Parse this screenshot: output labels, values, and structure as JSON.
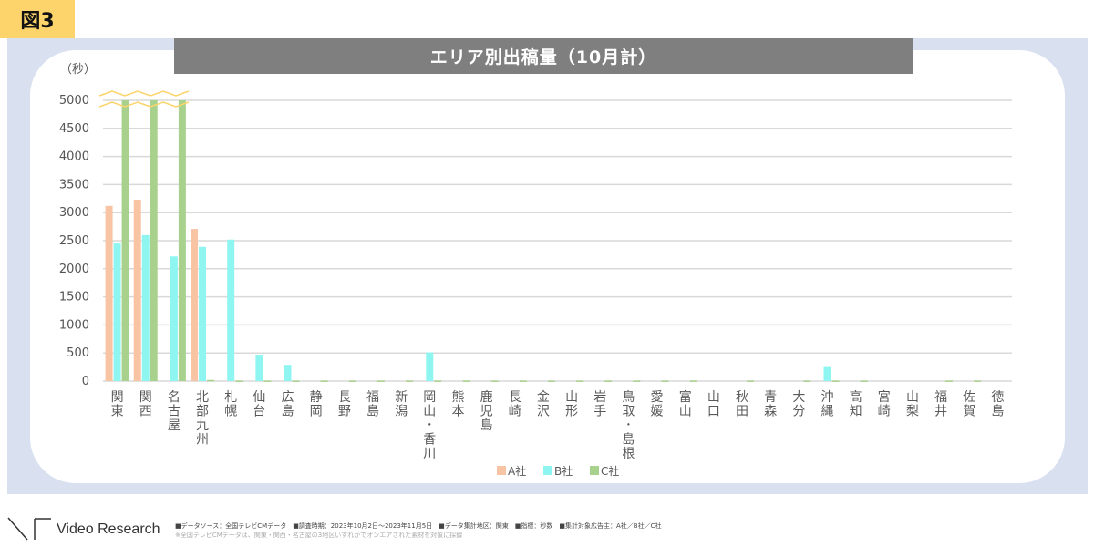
{
  "figure_label": "図3",
  "chart_data": {
    "type": "bar",
    "title": "エリア別出稿量（10月計）",
    "ylabel": "（秒）",
    "xlabel": "",
    "ylim": [
      0,
      5000
    ],
    "yticks": [
      0,
      500,
      1000,
      1500,
      2000,
      2500,
      3000,
      3500,
      4000,
      4500,
      5000
    ],
    "grid": true,
    "axis_break_note": "C社 values for 関東・関西・名古屋 exceed 5000 (axis broken)",
    "legend_position": "bottom",
    "categories": [
      "関東",
      "関西",
      "名古屋",
      "北部九州",
      "札幌",
      "仙台",
      "広島",
      "静岡",
      "長野",
      "福島",
      "新潟",
      "岡山・香川",
      "熊本",
      "鹿児島",
      "長崎",
      "金沢",
      "山形",
      "岩手",
      "鳥取・島根",
      "愛媛",
      "富山",
      "山口",
      "秋田",
      "青森",
      "大分",
      "沖縄",
      "高知",
      "宮崎",
      "山梨",
      "福井",
      "佐賀",
      "徳島"
    ],
    "series": [
      {
        "name": "A社",
        "color": "#f8c4a4",
        "values": [
          3120,
          3230,
          0,
          2710,
          0,
          0,
          0,
          0,
          0,
          0,
          0,
          0,
          0,
          0,
          0,
          0,
          0,
          0,
          0,
          0,
          0,
          0,
          0,
          0,
          0,
          0,
          0,
          0,
          0,
          0,
          0,
          0
        ]
      },
      {
        "name": "B社",
        "color": "#8ff5f0",
        "values": [
          2450,
          2600,
          2220,
          2390,
          2520,
          470,
          290,
          0,
          0,
          0,
          0,
          510,
          0,
          0,
          0,
          0,
          0,
          0,
          0,
          0,
          0,
          0,
          0,
          0,
          0,
          250,
          0,
          0,
          0,
          0,
          0,
          0
        ]
      },
      {
        "name": "C社",
        "color": "#a9d18e",
        "values": [
          5000,
          5000,
          5000,
          20,
          10,
          10,
          10,
          10,
          10,
          10,
          10,
          10,
          10,
          10,
          10,
          10,
          10,
          10,
          10,
          10,
          10,
          0,
          10,
          0,
          10,
          10,
          10,
          0,
          0,
          10,
          10,
          0
        ],
        "broken": [
          true,
          true,
          true,
          false,
          false,
          false,
          false,
          false,
          false,
          false,
          false,
          false,
          false,
          false,
          false,
          false,
          false,
          false,
          false,
          false,
          false,
          false,
          false,
          false,
          false,
          false,
          false,
          false,
          false,
          false,
          false,
          false
        ]
      }
    ]
  },
  "footer": {
    "brand": "Video Research",
    "line1": "■データソース：全国テレビCMデータ　■調査時期：2023年10月2日〜2023年11月5日　■データ集計地区：関東　■指標：秒数　■集計対象広告主：A社／B社／C社",
    "line2": "※全国テレビCMデータは、関東・関西・名古屋の3地区いずれかでオンエアされた素材を対象に採録"
  }
}
